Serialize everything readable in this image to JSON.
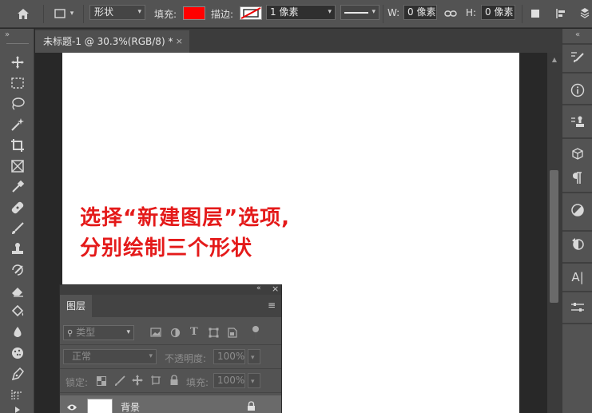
{
  "options_bar": {
    "mode": "形状",
    "fill_label": "填充:",
    "fill_color": "#ff0000",
    "stroke_label": "描边:",
    "stroke_width": "1 像素",
    "w_label": "W:",
    "w_value": "0 像素",
    "h_label": "H:",
    "h_value": "0 像素"
  },
  "tab": {
    "title": "未标题-1 @ 30.3%(RGB/8) *",
    "close": "×"
  },
  "canvas": {
    "annotation_line1": "选择“新建图层”选项,",
    "annotation_line2": "分别绘制三个形状",
    "annotation_color": "#e41a1a"
  },
  "layers_panel": {
    "tab_label": "图层",
    "kind_label": "类型",
    "blend_mode": "正常",
    "opacity_label": "不透明度:",
    "opacity_value": "100%",
    "lock_label": "锁定:",
    "fill_label": "填充:",
    "fill_value": "100%",
    "layer_name": "背景"
  },
  "right_strip": {
    "character_icon_label": "A|"
  }
}
